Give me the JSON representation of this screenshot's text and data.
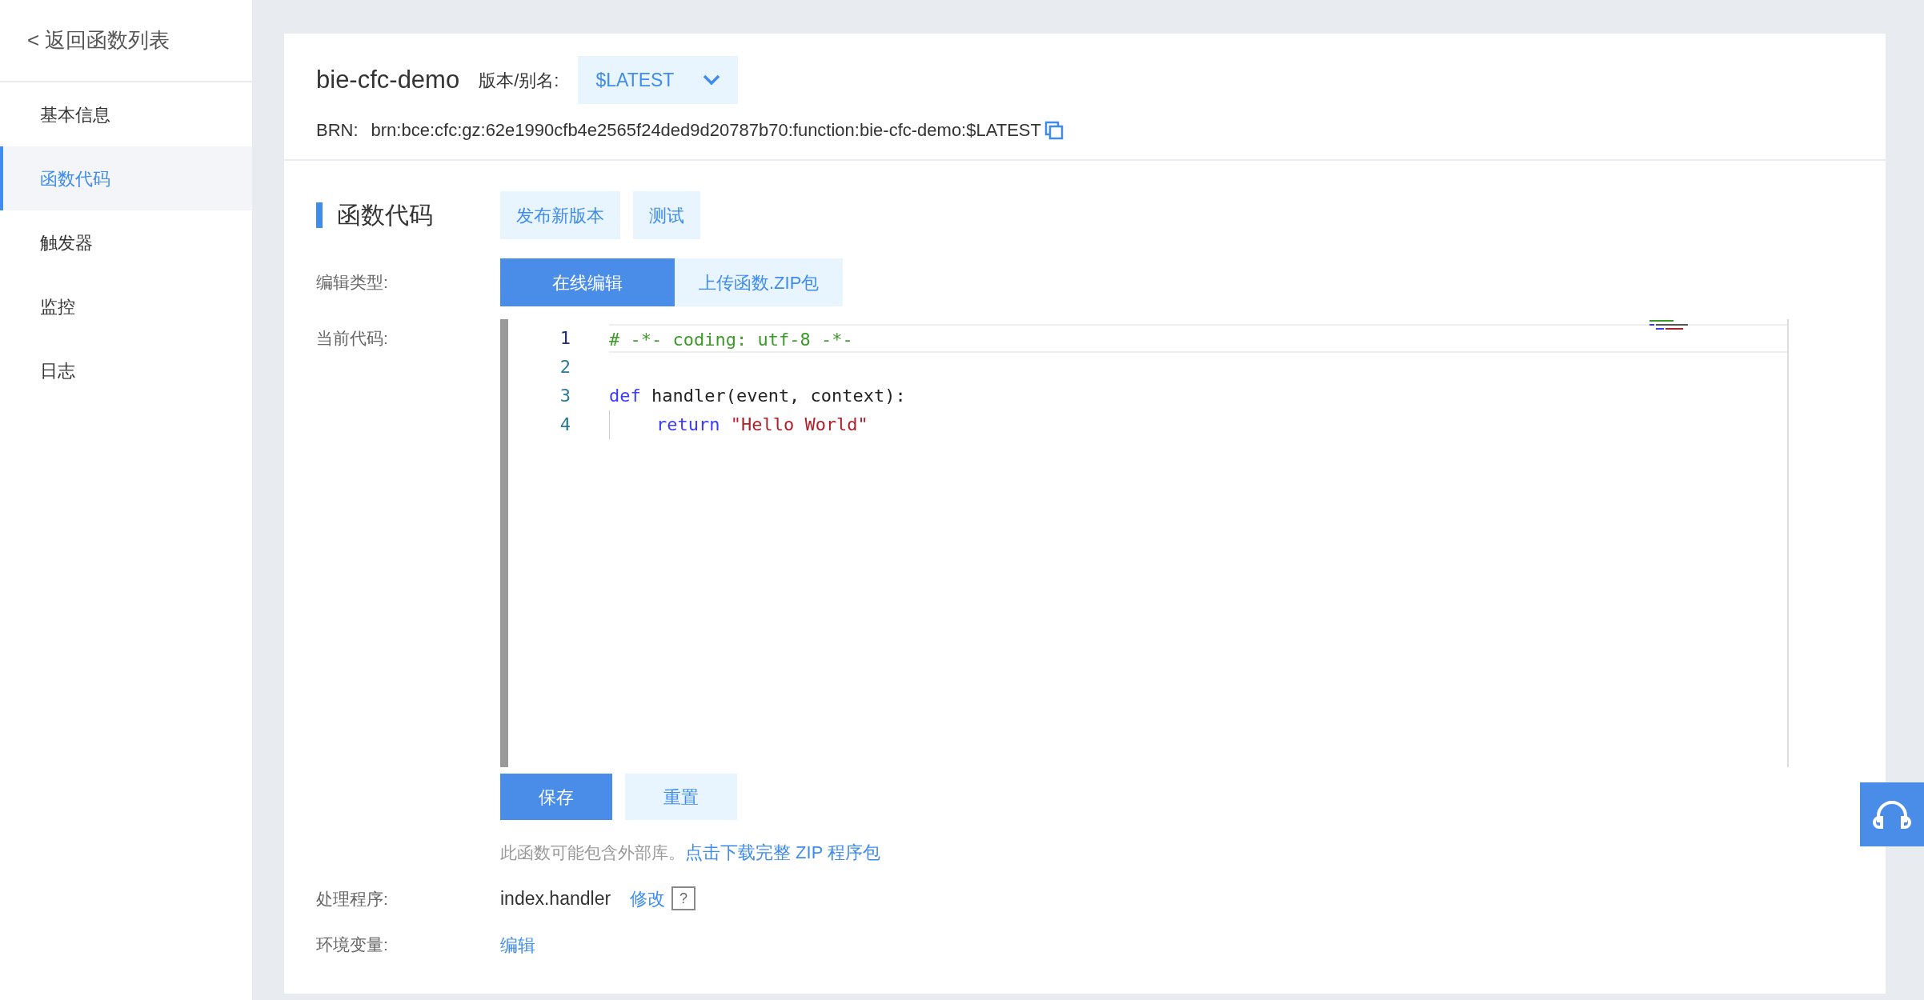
{
  "sidebar": {
    "back_link": "< 返回函数列表",
    "items": [
      {
        "label": "基本信息",
        "selected": false
      },
      {
        "label": "函数代码",
        "selected": true
      },
      {
        "label": "触发器",
        "selected": false
      },
      {
        "label": "监控",
        "selected": false
      },
      {
        "label": "日志",
        "selected": false
      }
    ]
  },
  "header": {
    "function_name": "bie-cfc-demo",
    "version_label": "版本/别名:",
    "version_value": "$LATEST",
    "brn_label": "BRN:",
    "brn_value": "brn:bce:cfc:gz:62e1990cfb4e2565f24ded9d20787b70:function:bie-cfc-demo:$LATEST"
  },
  "section": {
    "title": "函数代码",
    "actions": [
      "发布新版本",
      "测试"
    ]
  },
  "edit_type": {
    "label": "编辑类型:",
    "options": [
      {
        "label": "在线编辑",
        "selected": true
      },
      {
        "label": "上传函数.ZIP包",
        "selected": false
      }
    ]
  },
  "code": {
    "label": "当前代码:",
    "lines": [
      {
        "number": "1",
        "indented": false,
        "tokens": [
          {
            "kind": "comment",
            "text": "# -*- coding: utf-8 -*-"
          }
        ]
      },
      {
        "number": "2",
        "indented": false
      },
      {
        "number": "3",
        "indented": false,
        "tokens": [
          {
            "kind": "keyword",
            "text": "def"
          },
          {
            "kind": "plain",
            "text": "handler(event, context):"
          }
        ]
      },
      {
        "number": "4",
        "indented": true,
        "tokens": [
          {
            "kind": "keyword",
            "text": "return"
          },
          {
            "kind": "string",
            "text": "\"Hello World\""
          }
        ]
      }
    ]
  },
  "code_buttons": [
    {
      "label": "保存",
      "kind": "primary"
    },
    {
      "label": "重置",
      "kind": "secondary"
    }
  ],
  "note": {
    "text": "此函数可能包含外部库。",
    "link": "点击下载完整 ZIP 程序包"
  },
  "handler": {
    "label": "处理程序:",
    "value": "index.handler",
    "link": "修改",
    "help": "?"
  },
  "env": {
    "label": "环境变量:",
    "link": "编辑"
  }
}
